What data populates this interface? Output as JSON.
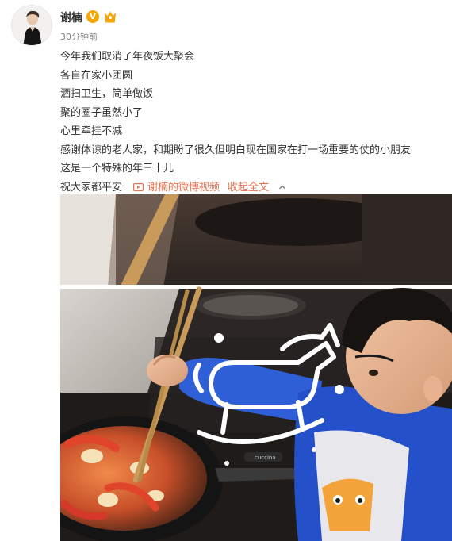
{
  "author": {
    "name": "谢楠",
    "timestamp": "30分钟前",
    "verified_badge": "V",
    "avatar_icon": "avatar-photo"
  },
  "post": {
    "lines": [
      "今年我们取消了年夜饭大聚会",
      "各自在家小团圆",
      "洒扫卫生，简单做饭",
      "聚的圈子虽然小了",
      "心里牵挂不减",
      "感谢体谅的老人家，和期盼了很久但明白现在国家在打一场重要的仗的小朋友",
      "这是一个特殊的年三十儿",
      "祝大家都平安"
    ],
    "video_link": "谢楠的微博视频",
    "collapse_link": "收起全文"
  },
  "media": {
    "pan_brand": "cuccina",
    "overlay_icon": "rocking-horse-icon"
  },
  "colors": {
    "link": "#eb7350",
    "badge_gold": "#f7a600",
    "text": "#333333",
    "meta": "#808080"
  }
}
